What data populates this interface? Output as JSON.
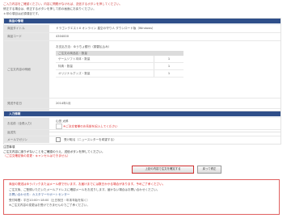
{
  "intro": {
    "line1": "ご入力内容をご確認ください。内容に問題がなければ、送信するボタンを押してください。",
    "line2": "修正する場合は、修正するボタンを押して前の画面にお戻りください。",
    "line3": "＊印の項目は必須項目です。"
  },
  "order_section": {
    "title": "商品の情報",
    "rows": {
      "product_name": {
        "label": "商品タイトル",
        "value": "ドラゴンクエストX オンライン 星空の守り人 ダウンロード版（Windows）"
      },
      "product_code": {
        "label": "商品コード",
        "value": "4304000"
      },
      "order_detail": {
        "label": "ご注文内容の明細",
        "value": "お支払方法：ゆうちょ銀行（振替払込み）"
      },
      "ship_date": {
        "label": "発送予定日",
        "value": "2014年1月"
      },
      "total": {
        "label": "お支払い合計",
        "value": "4,980円"
      }
    },
    "subtable": {
      "header": "ご注文の商品名・数量",
      "items": [
        {
          "name": "ゲームソフト本体・数量",
          "qty": "1"
        },
        {
          "name": "特典・数量",
          "qty": "1"
        },
        {
          "name": "オリジナルグッズ・数量",
          "qty": "1"
        }
      ]
    }
  },
  "customer_section": {
    "title": "入力情報",
    "rows": {
      "name": {
        "label": "お名前（全角入力）",
        "value": "山田 太郎",
        "note": "※ご注文者様のお名前を記入してください"
      },
      "mail": {
        "label": "返送先",
        "value": ""
      },
      "check": {
        "label": "メールマガジン",
        "value": "受け取る（ニュースレターを希望する）"
      }
    }
  },
  "notes": {
    "line1": "注意事項",
    "line2": "ご注文内容に誤りがないことをご確認のうえ、送信ボタンを押してください。",
    "line3": "（ご注文確定後の変更・キャンセルはできません）"
  },
  "buttons": {
    "submit": "上記の内容で注文を確定する",
    "back": "戻って修正"
  },
  "warning": {
    "line1": "商品の発送はゆうパックまたはメール便で行います。お届けまでには数日かかる場合があります。予めご了承ください。",
    "line2": "ご注文後、ご登録いただいたメールアドレスに確認メールをお送りします。届かない場合はお問い合わせください。",
    "line3": "お問い合わせ先：カスタマーサポートセンター",
    "line4": "受付時間：平日10:00～18:00（土日祝日・年末年始を除く）",
    "line5": "※ご注文内容の変更はお受けできませんのでご了承ください。"
  },
  "colors": {
    "header_bg": "#2f4f8a",
    "accent_red": "#e02a2a"
  }
}
